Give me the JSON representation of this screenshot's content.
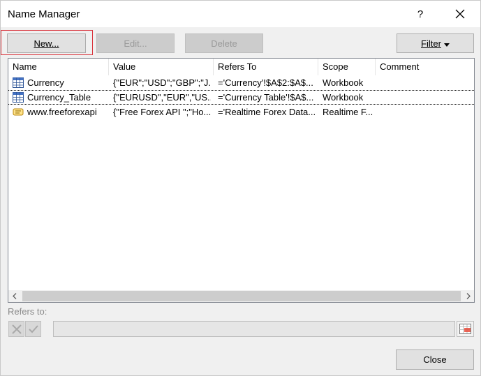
{
  "dialog": {
    "title": "Name Manager",
    "help_label": "?"
  },
  "toolbar": {
    "new_label": "New...",
    "edit_label": "Edit...",
    "delete_label": "Delete",
    "filter_label": "Filter"
  },
  "columns": [
    "Name",
    "Value",
    "Refers To",
    "Scope",
    "Comment"
  ],
  "rows": [
    {
      "icon": "table-icon",
      "name": "Currency",
      "value": "{\"EUR\";\"USD\";\"GBP\";\"J...",
      "refers_to": "='Currency'!$A$2:$A$...",
      "scope": "Workbook",
      "comment": ""
    },
    {
      "icon": "table-icon",
      "name": "Currency_Table",
      "value": "{\"EURUSD\",\"EUR\",\"US...",
      "refers_to": "='Currency Table'!$A$...",
      "scope": "Workbook",
      "comment": ""
    },
    {
      "icon": "query-table-icon",
      "name": "www.freeforexapi",
      "value": "{\"Free Forex API \";\"Ho...",
      "refers_to": "='Realtime Forex Data...",
      "scope": "Realtime F...",
      "comment": ""
    }
  ],
  "refers_to": {
    "label": "Refers to:",
    "value": ""
  },
  "footer": {
    "close_label": "Close"
  }
}
